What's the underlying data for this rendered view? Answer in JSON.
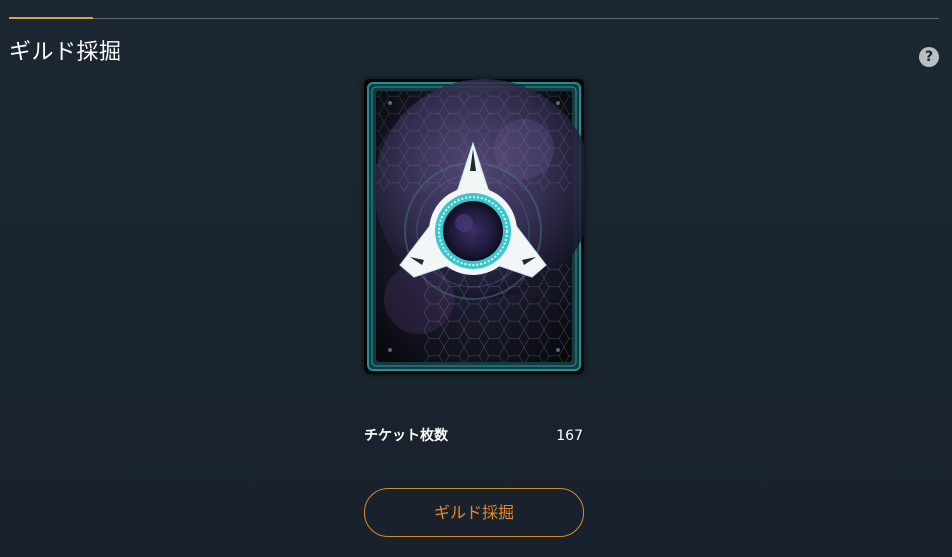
{
  "page": {
    "title": "ギルド採掘"
  },
  "help": {
    "icon": "question-circle-icon",
    "glyph": "?"
  },
  "card": {
    "icon": "guild-mining-emblem-icon"
  },
  "ticket": {
    "label": "チケット枚数",
    "value": "167"
  },
  "action": {
    "dig_label": "ギルド採掘"
  },
  "colors": {
    "background": "#1b2530",
    "accent_line": "#d5a64a",
    "button_border": "#d58a2a",
    "button_text": "#e0892a",
    "card_frame": "#1f6e73",
    "card_glow": "#3fd3d8"
  }
}
